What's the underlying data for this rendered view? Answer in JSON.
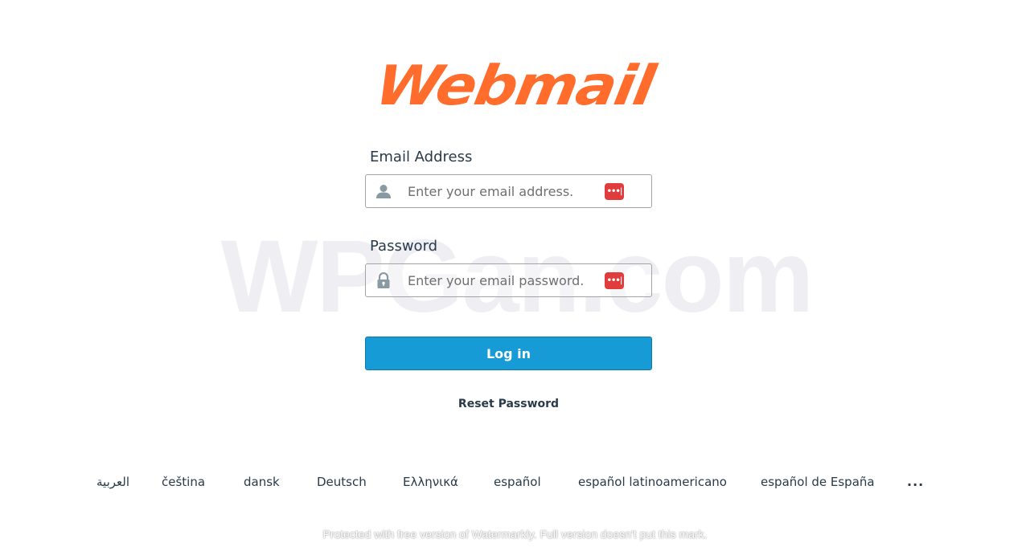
{
  "logo": {
    "text": "Webmail",
    "color": "#ff6c2c"
  },
  "watermark": {
    "text": "WPGan.com"
  },
  "form": {
    "email": {
      "label": "Email Address",
      "placeholder": "Enter your email address.",
      "value": "",
      "icon": "user-icon"
    },
    "password": {
      "label": "Password",
      "placeholder": "Enter your email password.",
      "value": "",
      "icon": "lock-icon"
    },
    "password_manager_icon": {
      "name": "password-manager-icon",
      "glyph": "•••|",
      "color": "#e03c3c"
    },
    "login_label": "Log in",
    "login_color": "#179bd7",
    "reset_label": "Reset Password"
  },
  "locales": {
    "items": [
      "العربية",
      "čeština",
      "dansk",
      "Deutsch",
      "Ελληνικά",
      "español",
      "español latinoamericano",
      "español de España"
    ],
    "more_label": "..."
  },
  "footer_note": "Protected with free version of Watermarkly. Full version doesn't put this mark."
}
